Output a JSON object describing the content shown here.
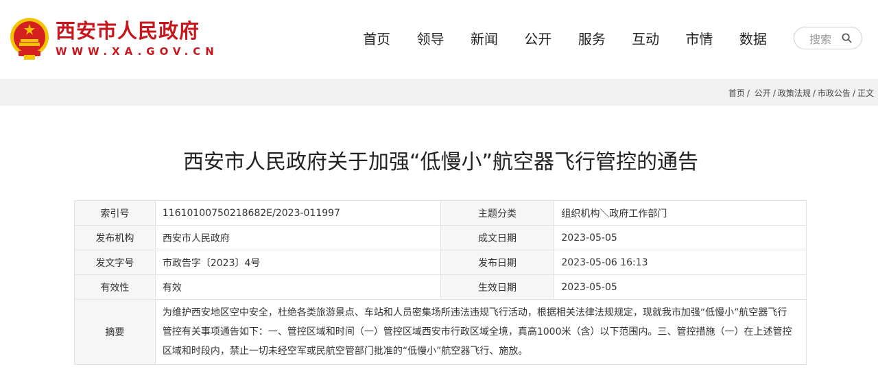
{
  "header": {
    "site_title": "西安市人民政府",
    "site_url": "WWW.XA.GOV.CN",
    "nav": [
      "首页",
      "领导",
      "新闻",
      "公开",
      "服务",
      "互动",
      "市情",
      "数据"
    ],
    "search_label": "搜索"
  },
  "breadcrumb": [
    "首页",
    "公开",
    "政策法规",
    "市政公告",
    "正文"
  ],
  "article": {
    "title": "西安市人民政府关于加强“低慢小”航空器飞行管控的通告"
  },
  "meta": {
    "index_label": "索引号",
    "index_value": "11610100750218682E/2023-011997",
    "topic_label": "主题分类",
    "topic_value": "组织机构＼政府工作部门",
    "publisher_label": "发布机构",
    "publisher_value": "西安市人民政府",
    "written_label": "成文日期",
    "written_value": "2023-05-05",
    "docno_label": "发文字号",
    "docno_value": "市政告字〔2023〕4号",
    "published_label": "发布日期",
    "published_value": "2023-05-06 16:13",
    "validity_label": "有效性",
    "validity_value": "有效",
    "effective_label": "生效日期",
    "effective_value": "2023-05-05",
    "abstract_label": "摘要",
    "abstract_value": "为维护西安地区空中安全，杜绝各类旅游景点、车站和人员密集场所违法违规飞行活动，根据相关法律法规规定，现就我市加强“低慢小”航空器飞行管控有关事项通告如下：一、管控区域和时间（一）管控区域西安市行政区域全境，真高1000米（含）以下范围内。三、管控措施（一）在上述管控区域和时段内，禁止一切未经空军或民航空管部门批准的“低慢小”航空器飞行、施放。"
  },
  "colors": {
    "brand_red": "#c8161d",
    "emblem_gold": "#f5c400",
    "crumb_bg": "#f1f1f1",
    "label_bg": "#f6f6f6"
  },
  "icons": [
    "national-emblem-icon",
    "search-icon"
  ]
}
